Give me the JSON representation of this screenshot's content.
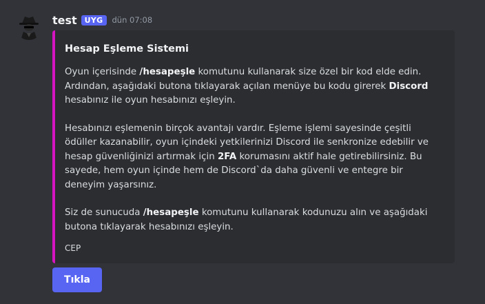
{
  "message": {
    "author": "test",
    "tag": "UYG",
    "timestamp": "dün 07:08",
    "avatar_icon": "spy-icon"
  },
  "embed": {
    "accent_color": "#d614c2",
    "title": "Hesap Eşleme Sistemi",
    "p1": {
      "t1": "Oyun içerisinde ",
      "b1": "/hesapeşle",
      "t2": " komutunu kullanarak size özel bir kod elde edin. Ardından, aşağıdaki butona tıklayarak açılan menüye bu kodu girerek ",
      "b2": "Discord",
      "t3": " hesabınız ile oyun hesabınızı eşleyin."
    },
    "p2": {
      "t1": "Hesabınızı eşlemenin birçok avantajı vardır. Eşleme işlemi sayesinde çeşitli ödüller kazanabilir, oyun içindeki yetkilerinizi Discord ile senkronize edebilir ve hesap güvenliğinizi artırmak için ",
      "b1": "2FA",
      "t2": " korumasını aktif hale getirebilirsiniz. Bu sayede, hem oyun içinde hem de Discord`da daha güvenli ve entegre bir deneyim yaşarsınız."
    },
    "p3": {
      "t1": "Siz de sunucuda ",
      "b1": "/hesapeşle",
      "t2": " komutunu kullanarak kodunuzu alın ve aşağıdaki butona tıklayarak hesabınızı eşleyin."
    },
    "footer": "CEP"
  },
  "button": {
    "label": "Tıkla",
    "color": "#5865f2"
  }
}
